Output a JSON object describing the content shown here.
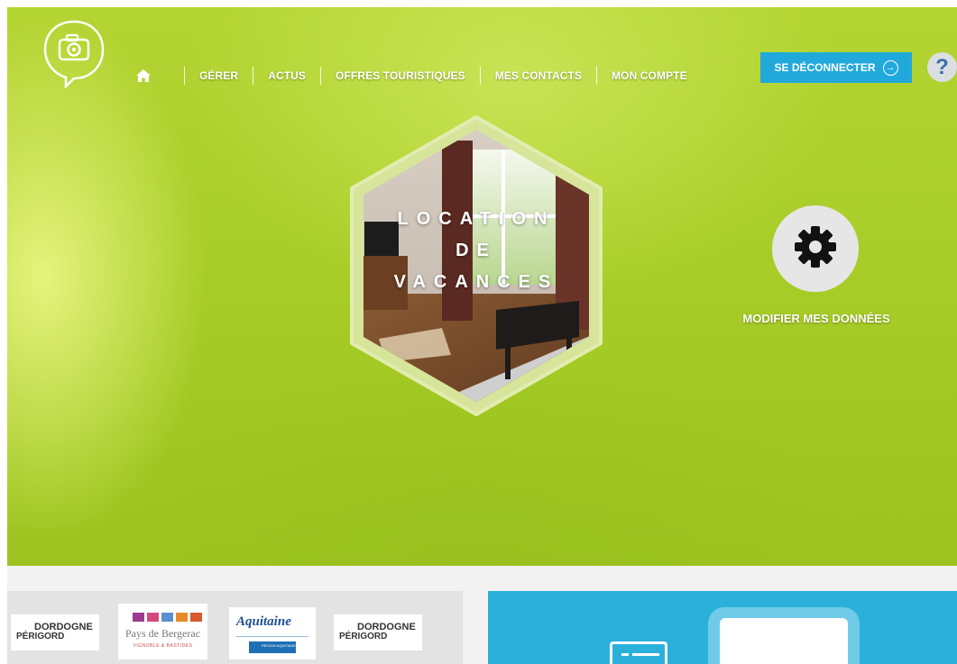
{
  "nav": {
    "home_icon": "home-icon",
    "items": [
      {
        "label": "GÉRER"
      },
      {
        "label": "ACTUS"
      },
      {
        "label": "OFFRES TOURISTIQUES"
      },
      {
        "label": "MES CONTACTS"
      },
      {
        "label": "MON COMPTE"
      }
    ]
  },
  "header": {
    "logout_label": "SE DÉCONNECTER",
    "logout_icon": "arrow-right-circle-icon",
    "help_label": "?"
  },
  "hero": {
    "title_line1": "LOCATION",
    "title_line2": "DE",
    "title_line3": "VACANCES",
    "settings_icon": "gear-icon",
    "settings_label": "MODIFIER MES DONNÉES"
  },
  "partners": {
    "dordogne_1": {
      "top": "DORDOGNE",
      "bottom": "PÉRIGORD"
    },
    "bergerac": {
      "name": "Pays de Bergerac",
      "tagline": "VIGNOBLE & BASTIDES"
    },
    "aquitaine": {
      "name": "Aquitaine",
      "region": "RÉGION AQUITAINE"
    },
    "dordogne_2": {
      "top": "DORDOGNE",
      "bottom": "PÉRIGORD"
    }
  },
  "colors": {
    "accent": "#22a9dc",
    "hero_green": "#a8cd28",
    "panel_blue": "#2bb0dc"
  }
}
